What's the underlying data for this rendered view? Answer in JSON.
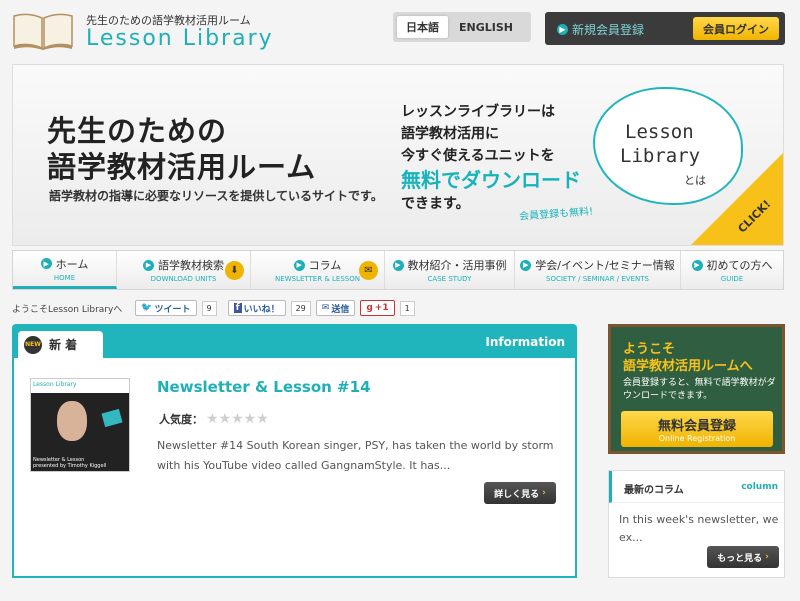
{
  "header": {
    "logo_subtitle": "先生のための語学教材活用ルーム",
    "logo_title": "Lesson Library",
    "lang": [
      {
        "label": "日本語",
        "active": true
      },
      {
        "label": "ENGLISH",
        "active": false
      }
    ],
    "register_label": "新規会員登録",
    "login_label": "会員ログイン"
  },
  "hero": {
    "heading_line1": "先生のための",
    "heading_line2": "語学教材活用ルーム",
    "subtext": "語学教材の指導に必要なリソースを提供しているサイトです。",
    "mid_line1": "レッスンライブラリーは",
    "mid_line2": "語学教材活用に",
    "mid_line3": "今すぐ使えるユニットを",
    "mid_free": "無料でダウンロード",
    "mid_line4": "できます。",
    "note": "会員登録も無料!",
    "cloud_line1": "Lesson",
    "cloud_line2": "Library",
    "cloud_line3": "とは",
    "click_label": "CLICK!"
  },
  "nav": [
    {
      "jp": "ホーム",
      "en": "HOME",
      "icon": "",
      "active": true
    },
    {
      "jp": "語学教材検索",
      "en": "DOWNLOAD UNITS",
      "icon": "download-icon",
      "active": false
    },
    {
      "jp": "コラム",
      "en": "NEWSLETTER & LESSON",
      "icon": "mail-icon",
      "active": false
    },
    {
      "jp": "教材紹介・活用事例",
      "en": "CASE STUDY",
      "icon": "",
      "active": false
    },
    {
      "jp": "学会/イベント/セミナー情報",
      "en": "SOCIETY / SEMINAR / EVENTS",
      "icon": "",
      "active": false
    },
    {
      "jp": "初めての方へ",
      "en": "GUIDE",
      "icon": "",
      "active": false
    }
  ],
  "social": {
    "welcome": "ようこそLesson Libraryへ",
    "tweet_label": "ツイート",
    "tweet_count": "9",
    "like_label": "いいね！",
    "like_count": "29",
    "send_label": "送信",
    "gplus_label": "+1",
    "gplus_count": "1"
  },
  "main": {
    "tab_label": "新 着",
    "new_badge": "NEW",
    "info_label": "Information",
    "article": {
      "thumb_title": "Lesson Library",
      "thumb_caption1": "Newsletter & Lesson",
      "thumb_caption2": "presented by Timothy Kiggell",
      "title": "Newsletter & Lesson #14",
      "popularity_label": "人気度：",
      "rating": 0,
      "excerpt": "Newsletter #14 South Korean singer, PSY, has taken the world by storm with his YouTube video called GangnamStyle. It has...",
      "more_label": "詳しく見る"
    }
  },
  "sidebar": {
    "welcome_line1": "ようこそ",
    "welcome_line2": "語学教材活用ルームへ",
    "welcome_text": "会員登録すると、無料で語学教材がダウンロードできます。",
    "free_register_jp": "無料会員登録",
    "free_register_en": "Online Registration",
    "column_title": "最新のコラム",
    "column_tag": "column",
    "column_text": "In this week's newsletter, we ex...",
    "column_more": "もっと見る"
  }
}
